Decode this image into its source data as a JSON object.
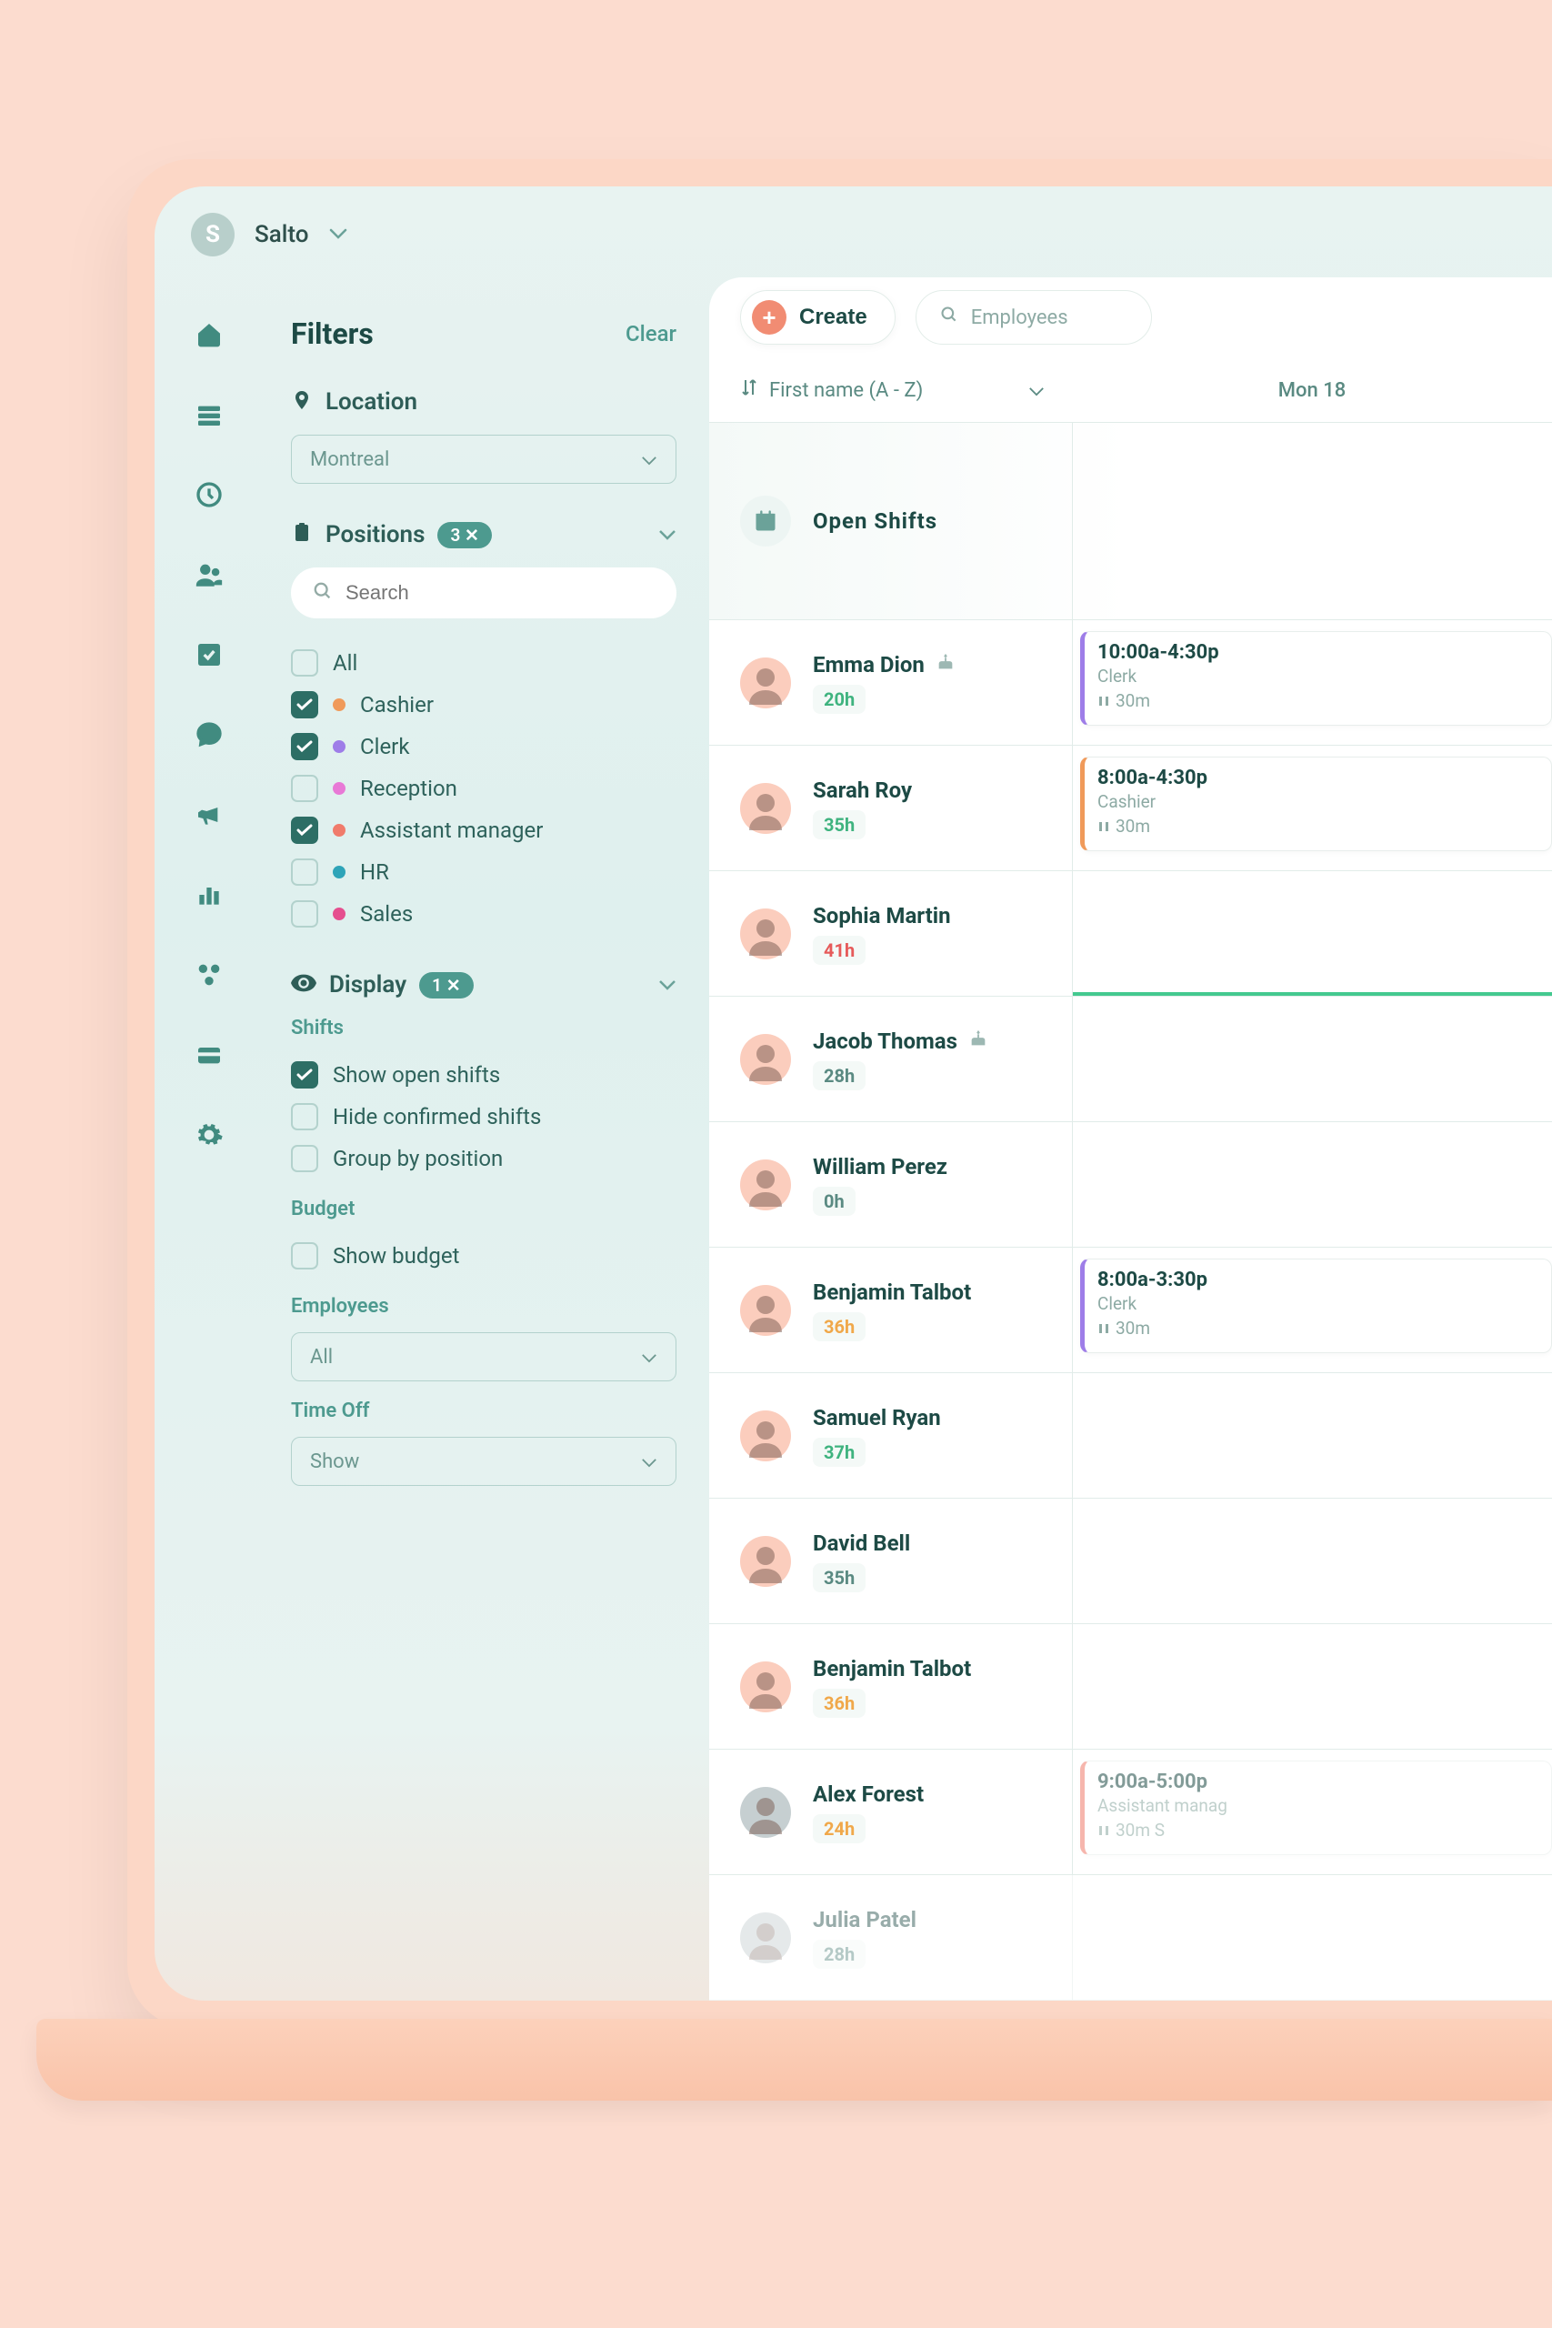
{
  "topbar": {
    "logoLetter": "S",
    "title": "Salto"
  },
  "filters": {
    "title": "Filters",
    "clear": "Clear",
    "location": {
      "label": "Location",
      "value": "Montreal"
    },
    "positions": {
      "label": "Positions",
      "badge": "3 ✕",
      "searchPlaceholder": "Search",
      "items": [
        {
          "label": "All",
          "checked": false,
          "color": null
        },
        {
          "label": "Cashier",
          "checked": true,
          "color": "#f09a5a"
        },
        {
          "label": "Clerk",
          "checked": true,
          "color": "#9e7de8"
        },
        {
          "label": "Reception",
          "checked": false,
          "color": "#e879d6"
        },
        {
          "label": "Assistant manager",
          "checked": true,
          "color": "#f07b6b"
        },
        {
          "label": "HR",
          "checked": false,
          "color": "#2ea4b8"
        },
        {
          "label": "Sales",
          "checked": false,
          "color": "#e54f8f"
        }
      ]
    },
    "display": {
      "label": "Display",
      "badge": "1 ✕",
      "shiftsHeader": "Shifts",
      "shifts": [
        {
          "label": "Show open shifts",
          "checked": true
        },
        {
          "label": "Hide confirmed shifts",
          "checked": false
        },
        {
          "label": "Group by position",
          "checked": false
        }
      ],
      "budgetHeader": "Budget",
      "budget": [
        {
          "label": "Show budget",
          "checked": false
        }
      ],
      "employeesHeader": "Employees",
      "employeesValue": "All",
      "timeoffHeader": "Time Off",
      "timeoffValue": "Show"
    }
  },
  "schedule": {
    "createLabel": "Create",
    "searchPlaceholder": "Employees",
    "sortLabel": "First name (A - Z)",
    "dayLabel": "Mon 18",
    "openShiftsLabel": "Open Shifts",
    "employees": [
      {
        "name": "Emma Dion",
        "hours": "20h",
        "hColor": "h-green",
        "birthday": true,
        "shift": {
          "time": "10:00a-4:30p",
          "position": "Clerk",
          "break": "30m",
          "color": "#9e7de8"
        }
      },
      {
        "name": "Sarah Roy",
        "hours": "35h",
        "hColor": "h-green",
        "birthday": false,
        "shift": {
          "time": "8:00a-4:30p",
          "position": "Cashier",
          "break": "30m",
          "color": "#f09a5a"
        }
      },
      {
        "name": "Sophia Martin",
        "hours": "41h",
        "hColor": "h-red",
        "birthday": false,
        "shift": null,
        "greenLine": true
      },
      {
        "name": "Jacob Thomas",
        "hours": "28h",
        "hColor": "h-gray",
        "birthday": true,
        "shift": null
      },
      {
        "name": "William Perez",
        "hours": "0h",
        "hColor": "h-gray",
        "birthday": false,
        "shift": null
      },
      {
        "name": "Benjamin Talbot",
        "hours": "36h",
        "hColor": "h-yellow",
        "birthday": false,
        "shift": {
          "time": "8:00a-3:30p",
          "position": "Clerk",
          "break": "30m",
          "color": "#9e7de8"
        }
      },
      {
        "name": "Samuel Ryan",
        "hours": "37h",
        "hColor": "h-green",
        "birthday": false,
        "shift": null
      },
      {
        "name": "David Bell",
        "hours": "35h",
        "hColor": "h-gray",
        "birthday": false,
        "shift": null
      },
      {
        "name": "Benjamin Talbot",
        "hours": "36h",
        "hColor": "h-yellow",
        "birthday": false,
        "shift": null
      },
      {
        "name": "Alex Forest",
        "hours": "24h",
        "hColor": "h-yellow",
        "birthday": false,
        "gray": true,
        "shift": {
          "time": "9:00a-5:00p",
          "position": "Assistant manag",
          "break": "30m S",
          "color": "#f07b6b",
          "faded": true
        }
      },
      {
        "name": "Julia Patel",
        "hours": "28h",
        "hColor": "h-gray",
        "birthday": false,
        "gray": true,
        "faded": true,
        "shift": null
      }
    ]
  }
}
